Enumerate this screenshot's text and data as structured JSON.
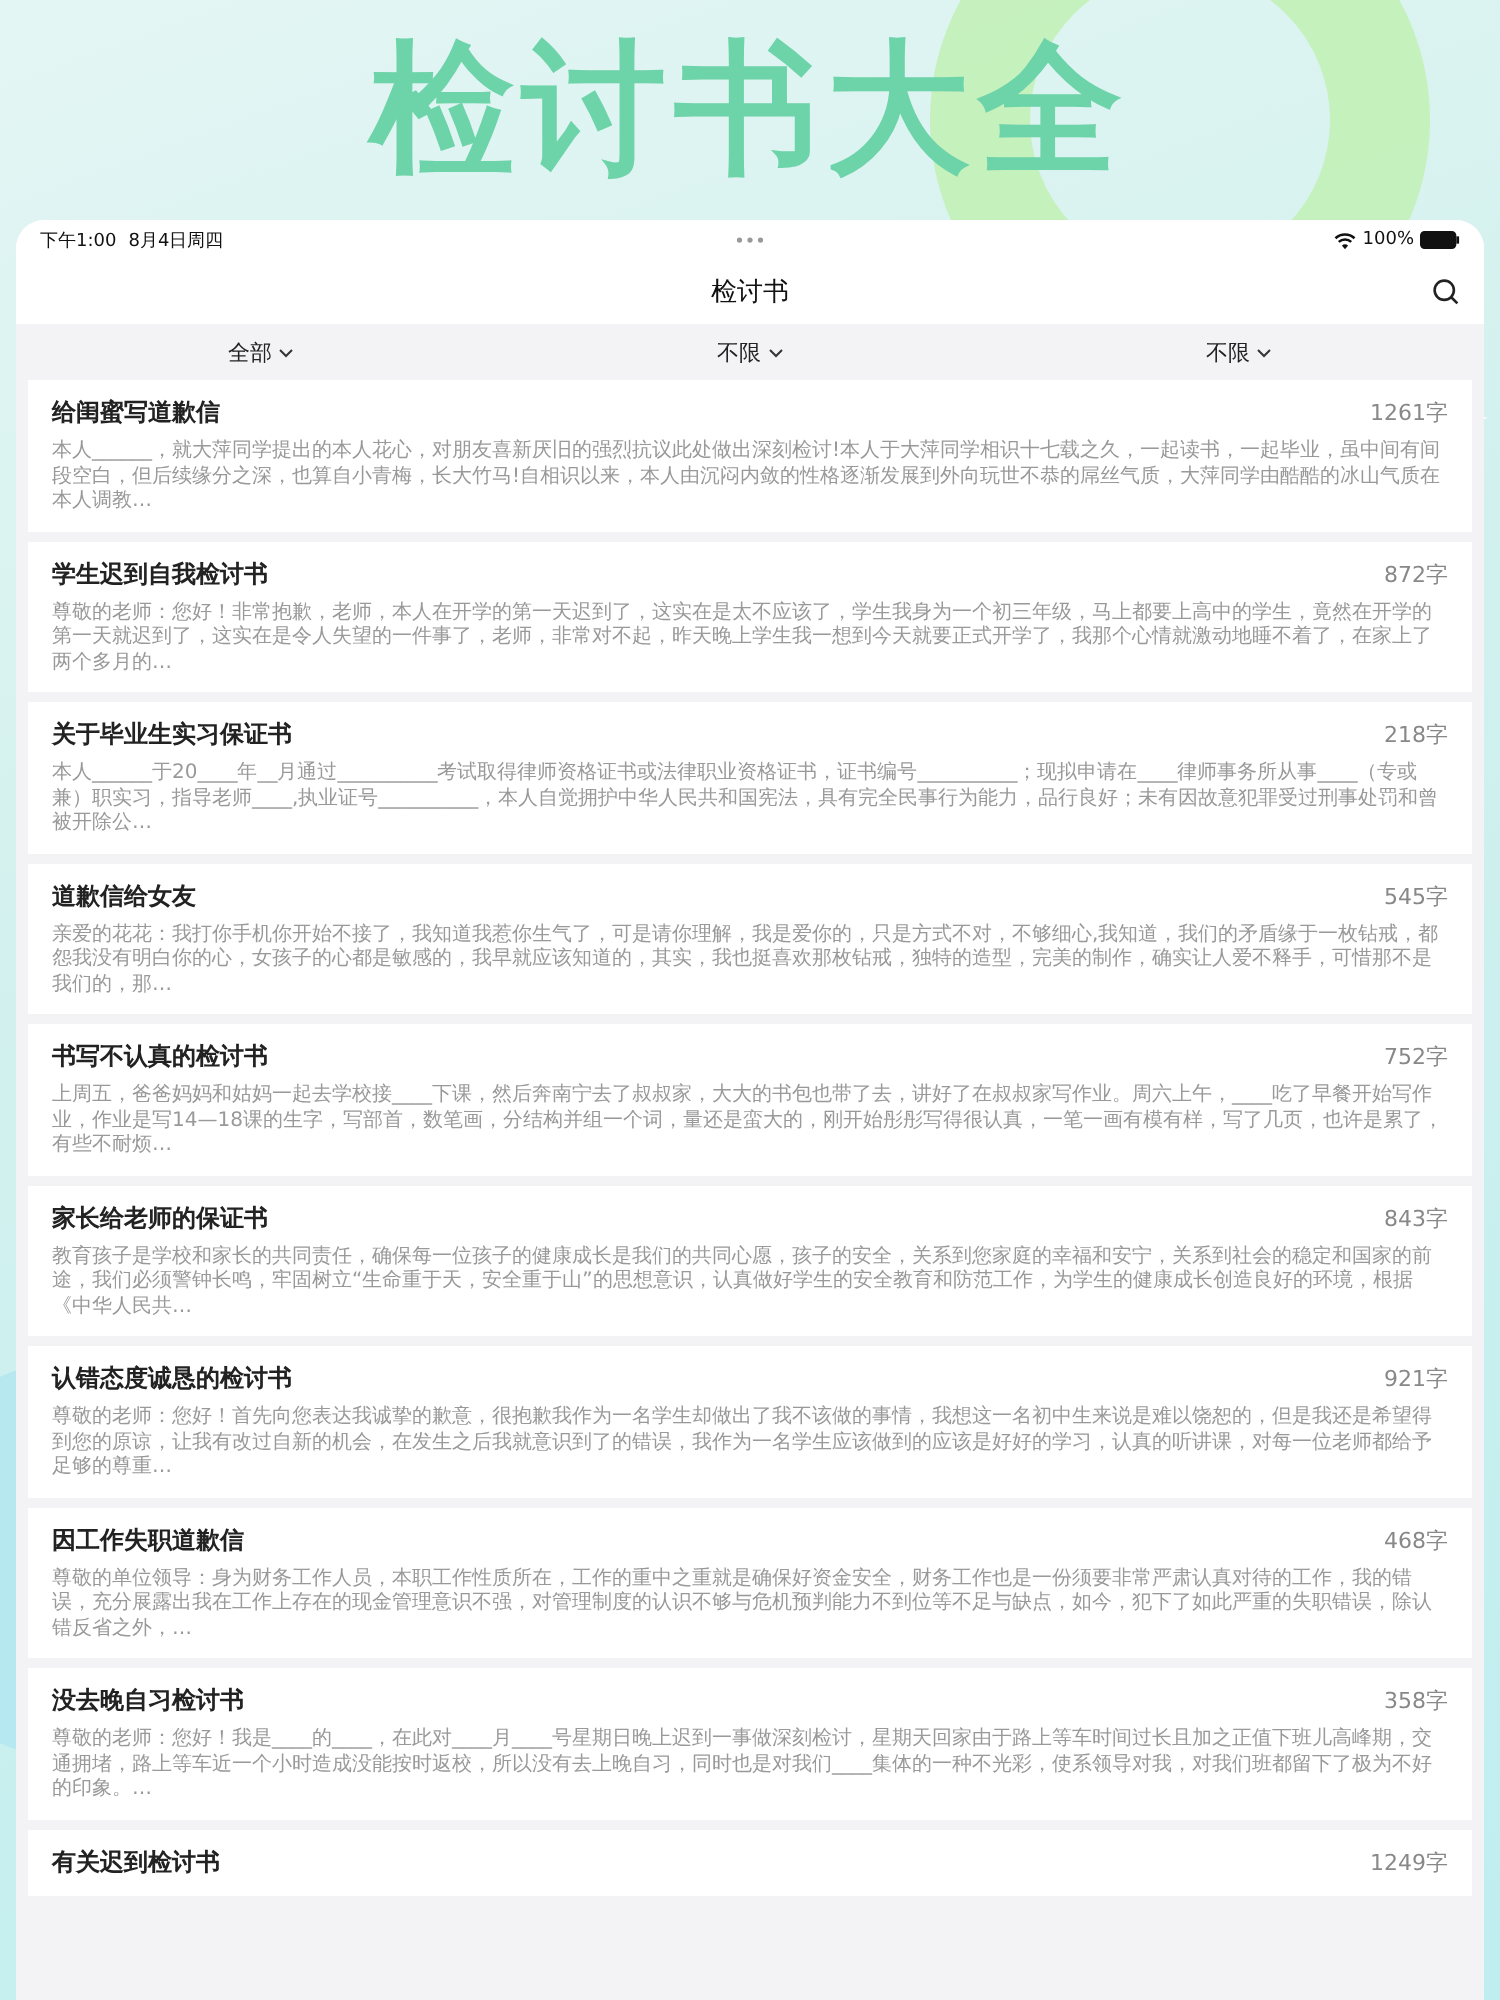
{
  "headline": "检讨书大全",
  "status_bar": {
    "time": "下午1:00",
    "date": "8月4日周四",
    "battery": "100%"
  },
  "nav": {
    "title": "检讨书"
  },
  "filters": [
    {
      "label": "全部"
    },
    {
      "label": "不限"
    },
    {
      "label": "不限"
    }
  ],
  "items": [
    {
      "title": "给闺蜜写道歉信",
      "count": "1261字",
      "excerpt": "本人______，就大萍同学提出的本人花心，对朋友喜新厌旧的强烈抗议此处做出深刻检讨!本人于大萍同学相识十七载之久，一起读书，一起毕业，虽中间有间段空白，但后续缘分之深，也算自小青梅，长大竹马!自相识以来，本人由沉闷内敛的性格逐渐发展到外向玩世不恭的屌丝气质，大萍同学由酷酷的冰山气质在本人调教…"
    },
    {
      "title": "学生迟到自我检讨书",
      "count": "872字",
      "excerpt": "尊敬的老师：您好！非常抱歉，老师，本人在开学的第一天迟到了，这实在是太不应该了，学生我身为一个初三年级，马上都要上高中的学生，竟然在开学的第一天就迟到了，这实在是令人失望的一件事了，老师，非常对不起，昨天晚上学生我一想到今天就要正式开学了，我那个心情就激动地睡不着了，在家上了两个多月的…"
    },
    {
      "title": "关于毕业生实习保证书",
      "count": "218字",
      "excerpt": "本人______于20____年__月通过__________考试取得律师资格证书或法律职业资格证书，证书编号__________；现拟申请在____律师事务所从事____（专或兼）职实习，指导老师____,执业证号__________，本人自觉拥护中华人民共和国宪法，具有完全民事行为能力，品行良好；未有因故意犯罪受过刑事处罚和曾被开除公…"
    },
    {
      "title": "道歉信给女友",
      "count": "545字",
      "excerpt": "亲爱的花花：我打你手机你开始不接了，我知道我惹你生气了，可是请你理解，我是爱你的，只是方式不对，不够细心,我知道，我们的矛盾缘于一枚钻戒，都怨我没有明白你的心，女孩子的心都是敏感的，我早就应该知道的，其实，我也挺喜欢那枚钻戒，独特的造型，完美的制作，确实让人爱不释手，可惜那不是我们的，那…"
    },
    {
      "title": "书写不认真的检讨书",
      "count": "752字",
      "excerpt": "上周五，爸爸妈妈和姑妈一起去学校接____下课，然后奔南宁去了叔叔家，大大的书包也带了去，讲好了在叔叔家写作业。周六上午，____吃了早餐开始写作业，作业是写14—18课的生字，写部首，数笔画，分结构并组一个词，量还是蛮大的，刚开始彤彤写得很认真，一笔一画有模有样，写了几页，也许是累了，有些不耐烦…"
    },
    {
      "title": "家长给老师的保证书",
      "count": "843字",
      "excerpt": "教育孩子是学校和家长的共同责任，确保每一位孩子的健康成长是我们的共同心愿，孩子的安全，关系到您家庭的幸福和安宁，关系到社会的稳定和国家的前途，我们必须警钟长鸣，牢固树立“生命重于天，安全重于山”的思想意识，认真做好学生的安全教育和防范工作，为学生的健康成长创造良好的环境，根据《中华人民共…"
    },
    {
      "title": "认错态度诚恳的检讨书",
      "count": "921字",
      "excerpt": "尊敬的老师：您好！首先向您表达我诚挚的歉意，很抱歉我作为一名学生却做出了我不该做的事情，我想这一名初中生来说是难以饶恕的，但是我还是希望得到您的原谅，让我有改过自新的机会，在发生之后我就意识到了的错误，我作为一名学生应该做到的应该是好好的学习，认真的听讲课，对每一位老师都给予足够的尊重…"
    },
    {
      "title": "因工作失职道歉信",
      "count": "468字",
      "excerpt": "尊敬的单位领导：身为财务工作人员，本职工作性质所在，工作的重中之重就是确保好资金安全，财务工作也是一份须要非常严肃认真对待的工作，我的错误，充分展露出我在工作上存在的现金管理意识不强，对管理制度的认识不够与危机预判能力不到位等不足与缺点，如今，犯下了如此严重的失职错误，除认错反省之外，…"
    },
    {
      "title": "没去晚自习检讨书",
      "count": "358字",
      "excerpt": "尊敬的老师：您好！我是____的____，在此对____月____号星期日晚上迟到一事做深刻检讨，星期天回家由于路上等车时间过长且加之正值下班儿高峰期，交通拥堵，路上等车近一个小时造成没能按时返校，所以没有去上晚自习，同时也是对我们____集体的一种不光彩，使系领导对我，对我们班都留下了极为不好的印象。…"
    },
    {
      "title": "有关迟到检讨书",
      "count": "1249字"
    }
  ]
}
